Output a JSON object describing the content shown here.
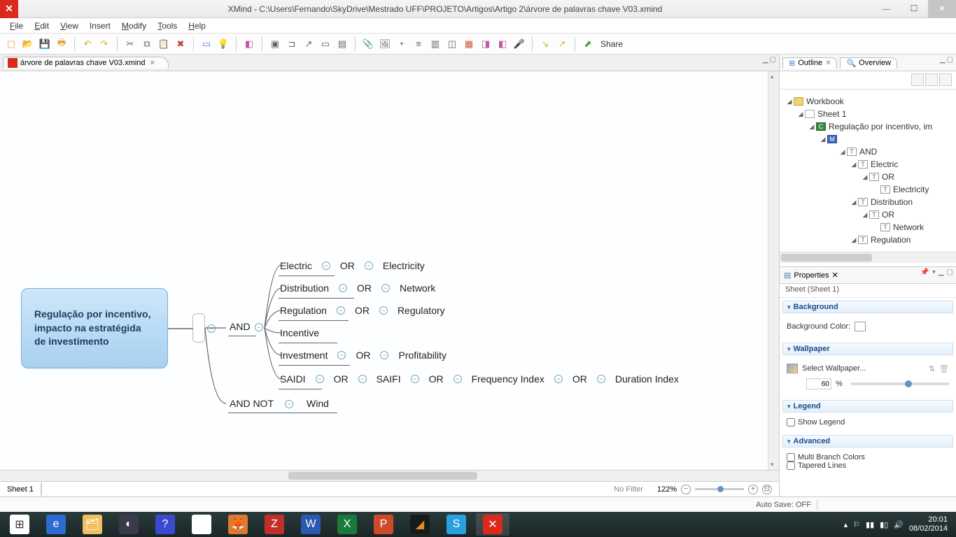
{
  "title": "XMind - C:\\Users\\Fernando\\SkyDrive\\Mestrado UFF\\PROJETO\\Artigos\\Artigo 2\\árvore de palavras chave V03.xmind",
  "menu": {
    "file": "File",
    "edit": "Edit",
    "view": "View",
    "insert": "Insert",
    "modify": "Modify",
    "tools": "Tools",
    "help": "Help"
  },
  "toolbar": {
    "share": "Share"
  },
  "editor_tab": "árvore de palavras chave V03.xmind",
  "mindmap": {
    "root": "Regulação por incentivo, impacto na estratégida de investimento",
    "and": "AND",
    "andnot": "AND NOT",
    "or": "OR",
    "branches": {
      "electric": "Electric",
      "electricity": "Electricity",
      "distribution": "Distribution",
      "network": "Network",
      "regulation": "Regulation",
      "regulatory": "Regulatory",
      "incentive": "Incentive",
      "investment": "Investment",
      "profitability": "Profitability",
      "saidi": "SAIDI",
      "saifi": "SAIFI",
      "freqidx": "Frequency Index",
      "duridx": "Duration Index",
      "wind": "Wind"
    }
  },
  "sheet_tab": "Sheet 1",
  "filter": "No Filter",
  "zoom": "122%",
  "right": {
    "outline_tab": "Outline",
    "overview_tab": "Overview",
    "tree": {
      "workbook": "Workbook",
      "sheet1": "Sheet 1",
      "root": "Regulação por incentivo, im",
      "and": "AND",
      "electric": "Electric",
      "or1": "OR",
      "electricity": "Electricity",
      "distribution": "Distribution",
      "or2": "OR",
      "network": "Network",
      "regulation": "Regulation"
    },
    "properties_tab": "Properties",
    "sheet_name": "Sheet (Sheet 1)",
    "background": "Background",
    "bgcolor": "Background Color:",
    "wallpaper": "Wallpaper",
    "sel_wallpaper": "Select Wallpaper...",
    "wp_pct": "60",
    "pct": "%",
    "legend": "Legend",
    "show_legend": "Show Legend",
    "advanced": "Advanced",
    "multi": "Multi Branch Colors",
    "tapered": "Tapered Lines"
  },
  "status": {
    "autosave": "Auto Save: OFF"
  },
  "taskbar": {
    "time": "20:01",
    "date": "08/02/2014"
  }
}
